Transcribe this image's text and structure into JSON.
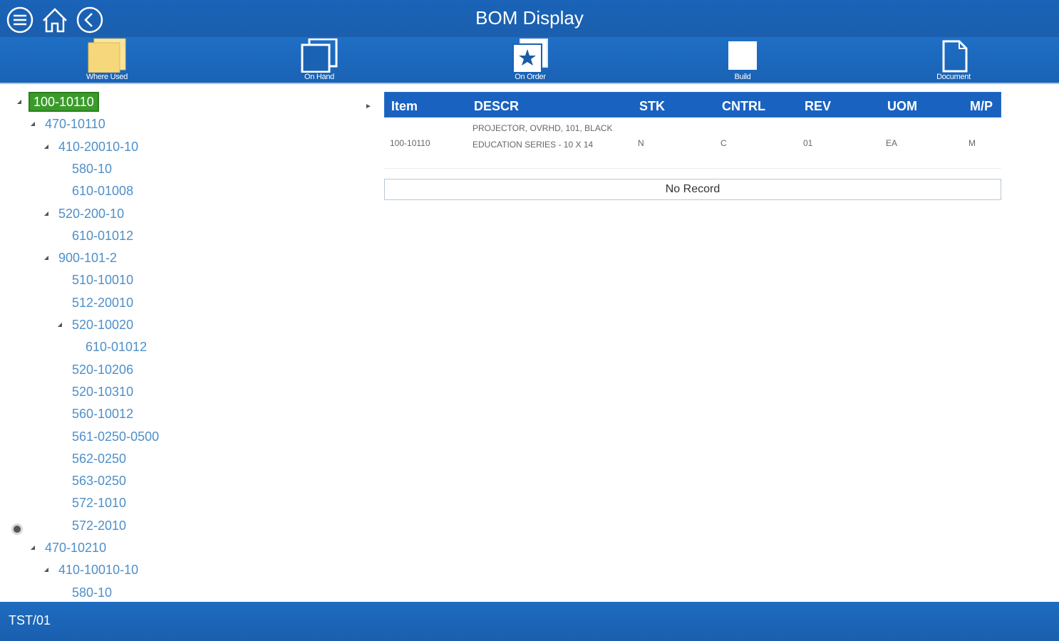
{
  "header": {
    "title": "BOM Display",
    "icons": [
      "menu-icon",
      "home-icon",
      "back-icon"
    ]
  },
  "toolbar": {
    "items": [
      {
        "label": "Where Used",
        "icon": "folder-icon"
      },
      {
        "label": "On Hand",
        "icon": "copy-icon"
      },
      {
        "label": "On Order",
        "icon": "star-document-icon"
      },
      {
        "label": "Build",
        "icon": "blank-page-icon"
      },
      {
        "label": "Document",
        "icon": "document-icon"
      }
    ]
  },
  "tree": {
    "nodes": [
      {
        "label": "100-10110",
        "level": 0,
        "expanded": true,
        "selected": true
      },
      {
        "label": "470-10110",
        "level": 1,
        "expanded": true
      },
      {
        "label": "410-20010-10",
        "level": 2,
        "expanded": true
      },
      {
        "label": "580-10",
        "level": 3
      },
      {
        "label": "610-01008",
        "level": 3
      },
      {
        "label": "520-200-10",
        "level": 2,
        "expanded": true
      },
      {
        "label": "610-01012",
        "level": 3
      },
      {
        "label": "900-101-2",
        "level": 2,
        "expanded": true
      },
      {
        "label": "510-10010",
        "level": 3
      },
      {
        "label": "512-20010",
        "level": 3
      },
      {
        "label": "520-10020",
        "level": 3,
        "expanded": true
      },
      {
        "label": "610-01012",
        "level": 4
      },
      {
        "label": "520-10206",
        "level": 3
      },
      {
        "label": "520-10310",
        "level": 3
      },
      {
        "label": "560-10012",
        "level": 3
      },
      {
        "label": "561-0250-0500",
        "level": 3
      },
      {
        "label": "562-0250",
        "level": 3
      },
      {
        "label": "563-0250",
        "level": 3
      },
      {
        "label": "572-1010",
        "level": 3
      },
      {
        "label": "572-2010",
        "level": 3
      },
      {
        "label": "470-10210",
        "level": 1,
        "expanded": true
      },
      {
        "label": "410-10010-10",
        "level": 2,
        "expanded": true
      },
      {
        "label": "580-10",
        "level": 3
      }
    ]
  },
  "grid": {
    "columns": [
      "Item",
      "DESCR",
      "STK",
      "CNTRL",
      "REV",
      "UOM",
      "M/P"
    ],
    "rows": [
      {
        "item": "100-10110",
        "descr": "PROJECTOR, OVRHD, 101, BLACK EDUCATION SERIES - 10 X 14",
        "stk": "N",
        "cntrl": "C",
        "rev": "01",
        "uom": "EA",
        "mp": "M"
      }
    ],
    "empty_message": "No Record"
  },
  "status": {
    "text": "TST/01"
  },
  "colors": {
    "header_blue": "#1a63b8",
    "selected_green": "#3a9b2a",
    "tree_link": "#4f8fc8",
    "folder_yellow": "#f6d77c"
  }
}
